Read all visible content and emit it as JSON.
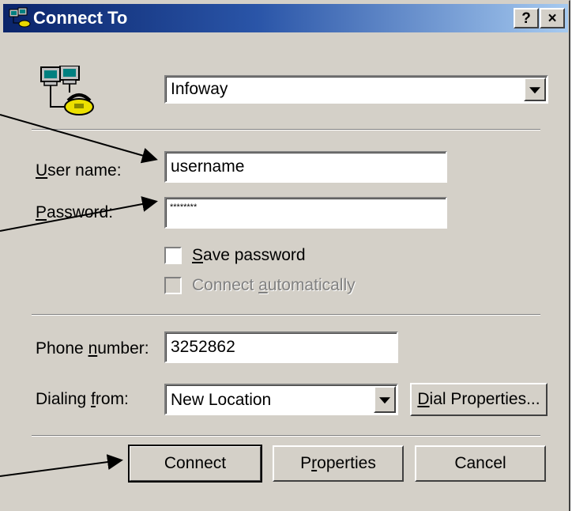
{
  "window": {
    "title": "Connect To",
    "help_button": "?",
    "close_button": "×"
  },
  "connection": {
    "selected": "Infoway"
  },
  "fields": {
    "username_label_u": "U",
    "username_label_rest": "ser name:",
    "username_value": "username",
    "password_label_u": "P",
    "password_label_rest": "assword:",
    "password_value": "********",
    "save_password_u": "S",
    "save_password_rest": "ave password",
    "connect_auto_pre": "Connect ",
    "connect_auto_u": "a",
    "connect_auto_rest": "utomatically",
    "phone_label_pre": "Phone ",
    "phone_label_u": "n",
    "phone_label_rest": "umber:",
    "phone_value": "3252862",
    "dialing_label_pre": "Dialing ",
    "dialing_label_u": "f",
    "dialing_label_rest": "rom:",
    "dialing_value": "New Location"
  },
  "buttons": {
    "dial_properties_u": "D",
    "dial_properties_rest": "ial Properties...",
    "connect": "Connect",
    "properties_pre": "P",
    "properties_u": "r",
    "properties_rest": "operties",
    "cancel": "Cancel"
  },
  "colors": {
    "title_bar_start": "#0a246a",
    "title_bar_end": "#a6caf0",
    "face": "#d4d0c8"
  },
  "icons": {
    "title": "network-connection-icon",
    "large": "dialup-computers-phone-icon",
    "dropdown": "chevron-down-icon"
  }
}
